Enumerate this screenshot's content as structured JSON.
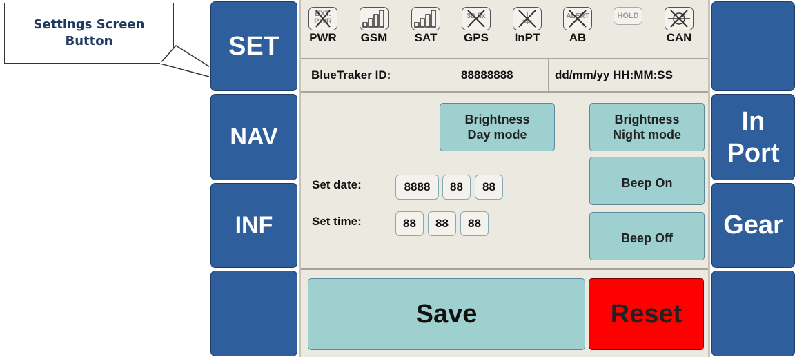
{
  "callout": {
    "line1": "Settings Screen",
    "line2": "Button"
  },
  "left_buttons": [
    "SET",
    "NAV",
    "INF",
    ""
  ],
  "right_buttons": [
    "",
    "In Port",
    "Gear",
    ""
  ],
  "status_icons": [
    {
      "label": "PWR",
      "icon": "ext-pwr-icon",
      "small": "EXT. PWR"
    },
    {
      "label": "GSM",
      "icon": "gsm-signal-icon"
    },
    {
      "label": "SAT",
      "icon": "sat-signal-icon"
    },
    {
      "label": "GPS",
      "icon": "gps-icon",
      "small": "3D fix"
    },
    {
      "label": "InPT",
      "icon": "inport-icon"
    },
    {
      "label": "AB",
      "icon": "alert-icon",
      "small": "ALERT"
    },
    {
      "label": "",
      "icon": "hold-icon",
      "small": "HOLD"
    },
    {
      "label": "CAN",
      "icon": "can-icon"
    }
  ],
  "id_row": {
    "label": "BlueTraker ID:",
    "value": "88888888",
    "datetime": "dd/mm/yy HH:MM:SS"
  },
  "brightness_day": "Brightness Day mode",
  "brightness_night": "Brightness Night mode",
  "beep_on": "Beep On",
  "beep_off": "Beep Off",
  "set_date_label": "Set date:",
  "set_time_label": "Set time:",
  "date_fields": [
    "8888",
    "88",
    "88"
  ],
  "time_fields": [
    "88",
    "88",
    "88"
  ],
  "save": "Save",
  "reset": "Reset",
  "colors": {
    "side_button": "#2e5f9c",
    "teal_button": "#9fd0d0",
    "reset_button": "#ff0000",
    "panel_bg": "#ece9e0"
  }
}
